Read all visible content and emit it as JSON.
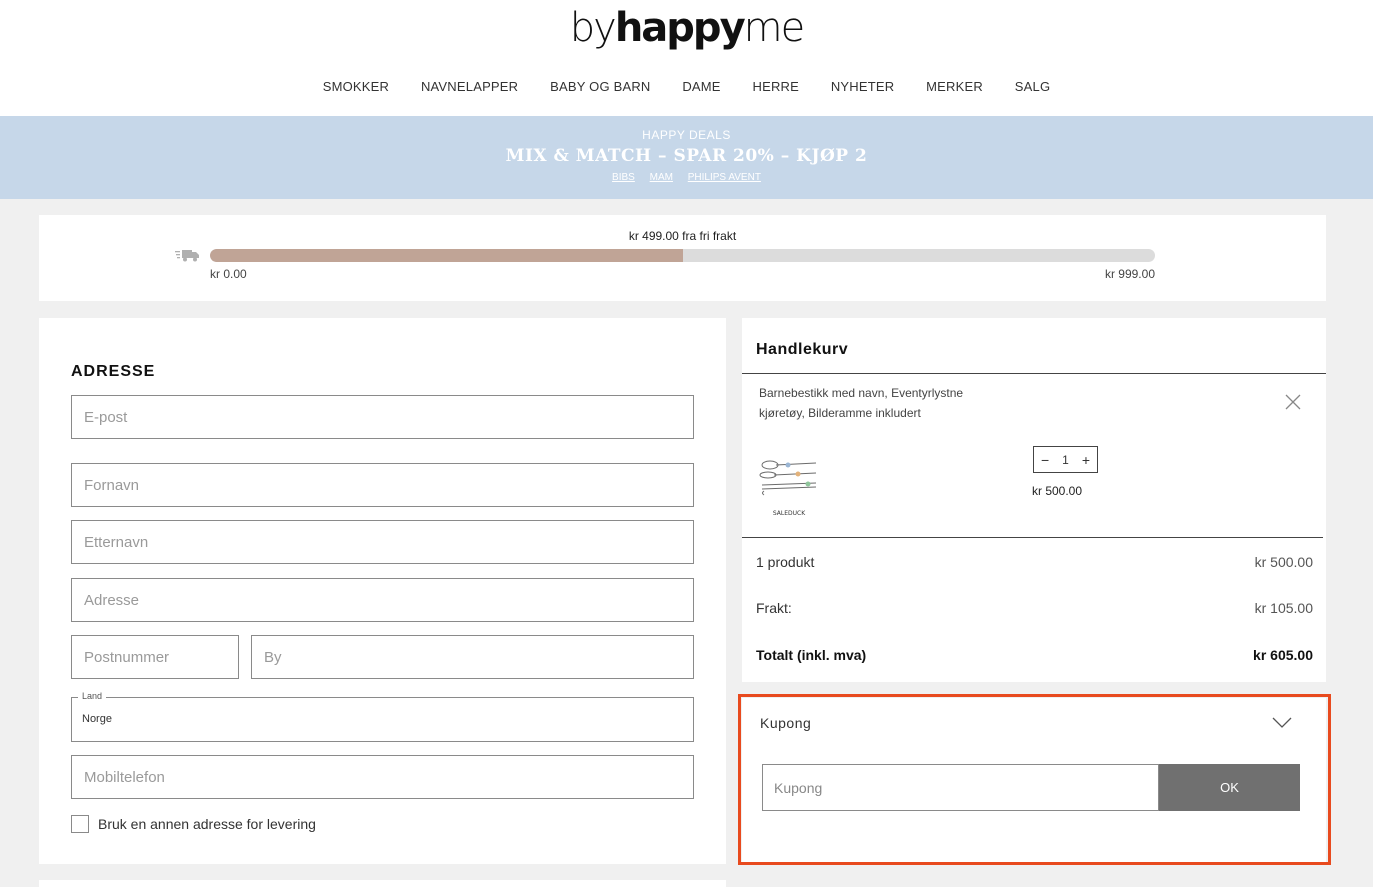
{
  "header": {
    "logo_light": "by",
    "logo_bold": "happy",
    "logo_end": "me",
    "nav": [
      "SMOKKER",
      "NAVNELAPPER",
      "BABY OG BARN",
      "DAME",
      "HERRE",
      "NYHETER",
      "MERKER",
      "SALG"
    ]
  },
  "banner": {
    "subtitle": "HAPPY DEALS",
    "title": "MIX & MATCH – SPAR 20% – KJØP 2",
    "links": [
      "BIBS",
      "MAM",
      "PHILIPS AVENT"
    ],
    "bg_color": "#c6d7e9"
  },
  "shipping": {
    "label": "kr 499.00 fra fri frakt",
    "min_label": "kr 0.00",
    "max_label": "kr 999.00",
    "progress_fraction": 0.5,
    "fill_color": "#c0a496",
    "icon": "truck-icon"
  },
  "address": {
    "title": "ADRESSE",
    "email_placeholder": "E-post",
    "firstname_placeholder": "Fornavn",
    "lastname_placeholder": "Etternavn",
    "address_placeholder": "Adresse",
    "postcode_placeholder": "Postnummer",
    "city_placeholder": "By",
    "country_label": "Land",
    "country_value": "Norge",
    "phone_placeholder": "Mobiltelefon",
    "alt_delivery_label": "Bruk en annen adresse for levering"
  },
  "cart": {
    "title": "Handlekurv",
    "item": {
      "name": "Barnebestikk med navn, Eventyrlystne kjøretøy, Bilderamme inkludert",
      "quantity": "1",
      "price": "kr 500.00",
      "thumb_caption": "SALEDUCK"
    },
    "products_label": "1 produkt",
    "products_value": "kr 500.00",
    "shipping_label": "Frakt:",
    "shipping_value": "kr 105.00",
    "total_label": "Totalt (inkl. mva)",
    "total_value": "kr 605.00"
  },
  "coupon": {
    "heading": "Kupong",
    "placeholder": "Kupong",
    "ok_label": "OK",
    "highlight_color": "#e84a1e"
  }
}
